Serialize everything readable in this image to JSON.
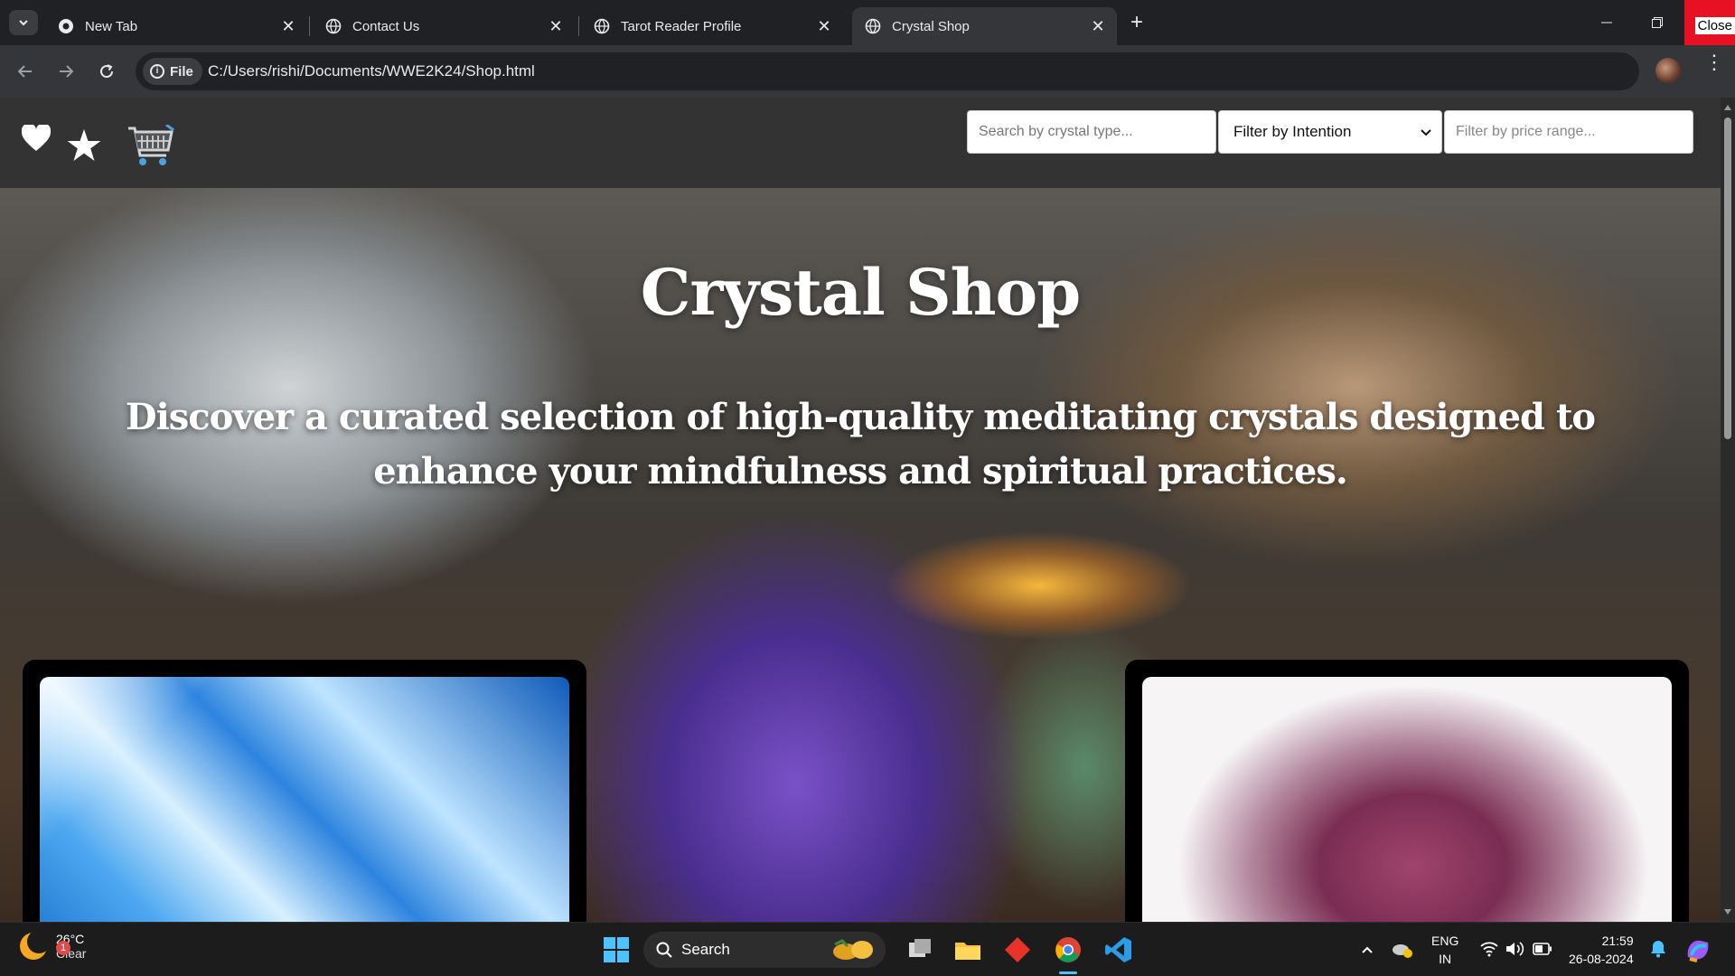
{
  "browser": {
    "tabs": [
      {
        "title": "New Tab",
        "active": false
      },
      {
        "title": "Contact Us",
        "active": false
      },
      {
        "title": "Tarot Reader Profile",
        "active": false
      },
      {
        "title": "Crystal Shop",
        "active": true
      }
    ],
    "close_label": "Close",
    "file_chip": "File",
    "url": "C:/Users/rishi/Documents/WWE2K24/Shop.html"
  },
  "header": {
    "search_placeholder": "Search by crystal type...",
    "intention_selected": "Filter by Intention",
    "price_placeholder": "Filter by price range...",
    "icons": [
      "heart-icon",
      "star-icon",
      "cart-icon"
    ]
  },
  "hero": {
    "title": "Crystal Shop",
    "subtitle": "Discover a curated selection of high-quality meditating crystals designed to enhance your mindfulness and spiritual practices."
  },
  "taskbar": {
    "weather_temp": "26°C",
    "weather_desc": "Clear",
    "weather_badge": "1",
    "search_label": "Search",
    "lang_line1": "ENG",
    "lang_line2": "IN",
    "time": "21:59",
    "date": "26-08-2024"
  }
}
